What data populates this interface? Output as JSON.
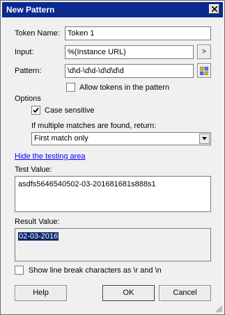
{
  "window": {
    "title": "New Pattern",
    "close_icon": "close-icon"
  },
  "form": {
    "token_name_label": "Token Name:",
    "token_name_value": "Token 1",
    "input_label": "Input:",
    "input_value": "%(Instance URL)",
    "input_button_label": ">",
    "pattern_label": "Pattern:",
    "pattern_value": "\\d\\d-\\d\\d-\\d\\d\\d\\d",
    "pattern_button_icon": "token-grid-icon",
    "allow_tokens_label": "Allow tokens in the pattern",
    "allow_tokens_checked": false
  },
  "options": {
    "heading": "Options",
    "case_sensitive_label": "Case sensitive",
    "case_sensitive_checked": true,
    "multiple_matches_label": "If multiple matches are found, return:",
    "multiple_matches_value": "First match only"
  },
  "testing": {
    "hide_link": "Hide the testing area",
    "test_value_label": "Test Value:",
    "test_value": "asdfs5646540502-03-201681681s888s1",
    "result_value_label": "Result Value:",
    "result_value": "02-03-2016",
    "line_break_label": "Show line break characters as \\r and \\n",
    "line_break_checked": false
  },
  "buttons": {
    "help": "Help",
    "ok": "OK",
    "cancel": "Cancel"
  },
  "colors": {
    "title_bar": "#0b2a8f",
    "link": "#0000ff",
    "selection": "#0a246a"
  }
}
